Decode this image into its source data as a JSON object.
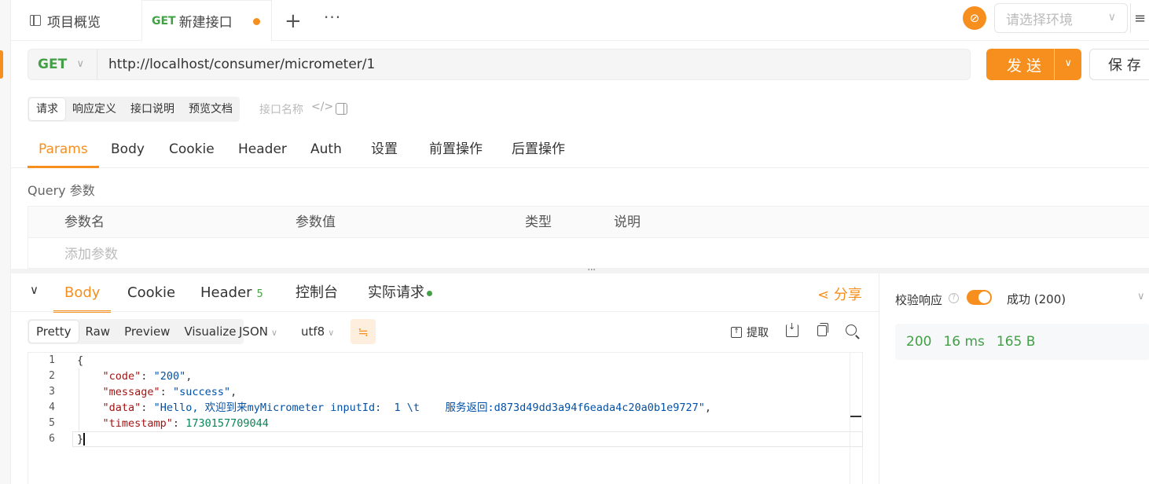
{
  "tabs": {
    "overview_label": "项目概览",
    "new_method": "GET",
    "new_label": "新建接口",
    "add_icon": "+",
    "more_icon": "···"
  },
  "env": {
    "placeholder": "请选择环境"
  },
  "request": {
    "method": "GET",
    "url": "http://localhost/consumer/micrometer/1",
    "send_label": "发 送",
    "save_label": "保 存"
  },
  "doc_tabs": [
    "请求",
    "响应定义",
    "接口说明",
    "预览文档"
  ],
  "api_name_placeholder": "接口名称",
  "request_tabs": [
    "Params",
    "Body",
    "Cookie",
    "Header",
    "Auth",
    "设置",
    "前置操作",
    "后置操作"
  ],
  "query": {
    "label": "Query 参数",
    "columns": [
      "参数名",
      "参数值",
      "类型",
      "说明"
    ],
    "add_placeholder": "添加参数"
  },
  "response": {
    "tabs": {
      "body": "Body",
      "cookie": "Cookie",
      "header": "Header",
      "header_count": "5",
      "console": "控制台",
      "real_request": "实际请求"
    },
    "share_label": "分享",
    "formats": [
      "Pretty",
      "Raw",
      "Preview",
      "Visualize"
    ],
    "content_type": "JSON",
    "encoding": "utf8",
    "extract_label": "提取",
    "line_numbers": [
      "1",
      "2",
      "3",
      "4",
      "5",
      "6"
    ],
    "body": {
      "open": "{",
      "code_key": "\"code\"",
      "code_val": "\"200\"",
      "message_key": "\"message\"",
      "message_val": "\"success\"",
      "data_key": "\"data\"",
      "data_val": "\"Hello, 欢迎到来myMicrometer inputId:  1 \\t    服务返回:d873d49dd3a94f6eada4c20a0b1e9727\"",
      "timestamp_key": "\"timestamp\"",
      "timestamp_val": "1730157709044",
      "close": "}"
    }
  },
  "validation": {
    "label": "校验响应",
    "result": "成功 (200)",
    "status": "200",
    "time": "16 ms",
    "size": "165 B"
  },
  "colors": {
    "accent": "#f78f1e",
    "method_get": "#43a047",
    "success": "#43a047"
  }
}
